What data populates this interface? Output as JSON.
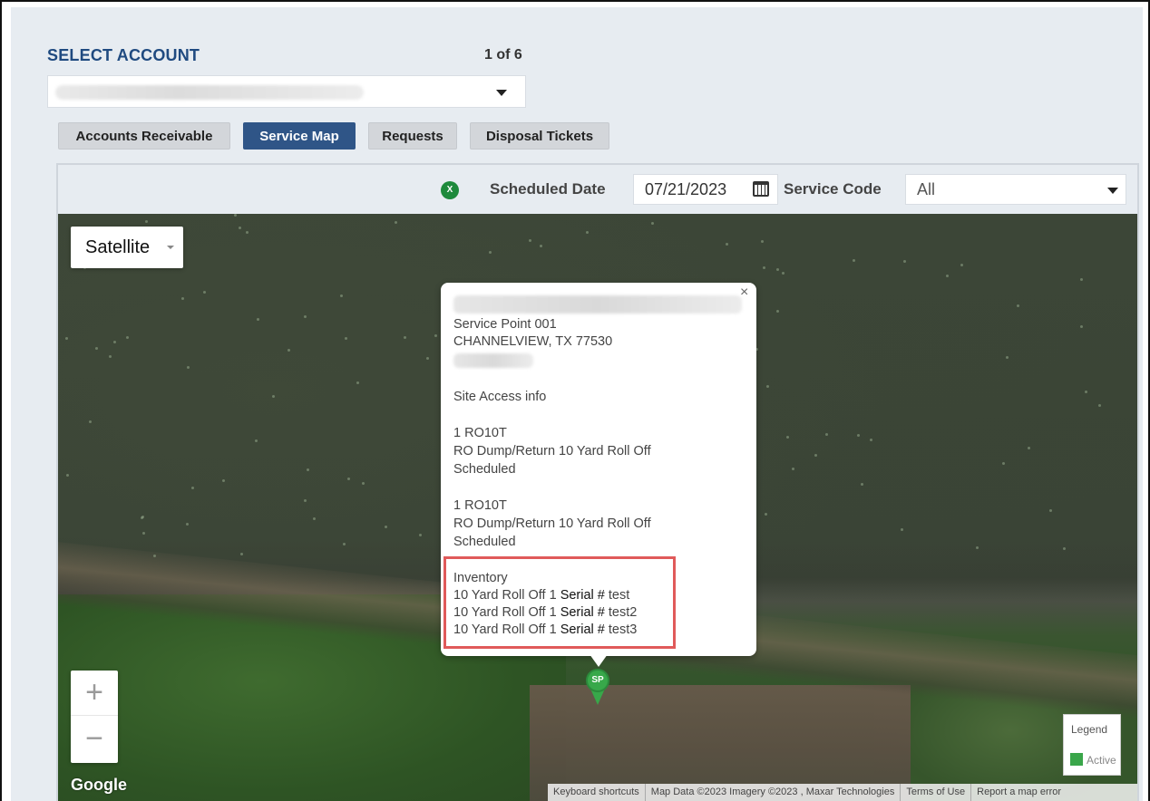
{
  "account": {
    "title": "SELECT ACCOUNT",
    "count": "1 of 6",
    "selected": ""
  },
  "tabs": [
    {
      "label": "Accounts Receivable",
      "active": false
    },
    {
      "label": "Service Map",
      "active": true
    },
    {
      "label": "Requests",
      "active": false
    },
    {
      "label": "Disposal Tickets",
      "active": false
    }
  ],
  "toolbar": {
    "excel_icon": "excel-icon",
    "scheduled_date_label": "Scheduled Date",
    "scheduled_date_value": "07/21/2023",
    "calendar_icon": "calendar-icon",
    "service_code_label": "Service Code",
    "service_code_value": "All"
  },
  "map": {
    "type_button": "Satellite",
    "zoom_in": "+",
    "zoom_out": "−",
    "logo": "Google",
    "attribution": [
      "Keyboard shortcuts",
      "Map Data ©2023 Imagery ©2023 , Maxar Technologies",
      "Terms of Use",
      "Report a map error"
    ],
    "legend": {
      "title": "Legend",
      "items": [
        {
          "label": "Active",
          "color": "#3aa64a"
        }
      ]
    },
    "marker_label": "SP"
  },
  "popup": {
    "close": "×",
    "service_point": "Service Point 001",
    "city_line": "CHANNELVIEW, TX 77530",
    "site_access": "Site Access info",
    "services": [
      {
        "code": "1 RO10T",
        "description": "RO Dump/Return 10 Yard Roll Off",
        "status": "Scheduled"
      },
      {
        "code": "1 RO10T",
        "description": "RO Dump/Return 10 Yard Roll Off",
        "status": "Scheduled"
      }
    ],
    "inventory": {
      "title": "Inventory",
      "items": [
        {
          "prefix": "10 Yard Roll Off 1 ",
          "serial_label": "Serial #",
          "serial": " test"
        },
        {
          "prefix": "10 Yard Roll Off 1 ",
          "serial_label": "Serial #",
          "serial": " test2"
        },
        {
          "prefix": "10 Yard Roll Off 1 ",
          "serial_label": "Serial #",
          "serial": " test3"
        }
      ]
    }
  },
  "colors": {
    "brand": "#1f4a80",
    "active_tab": "#2f5587",
    "highlight": "#e05a5a",
    "marker": "#38a84a"
  }
}
